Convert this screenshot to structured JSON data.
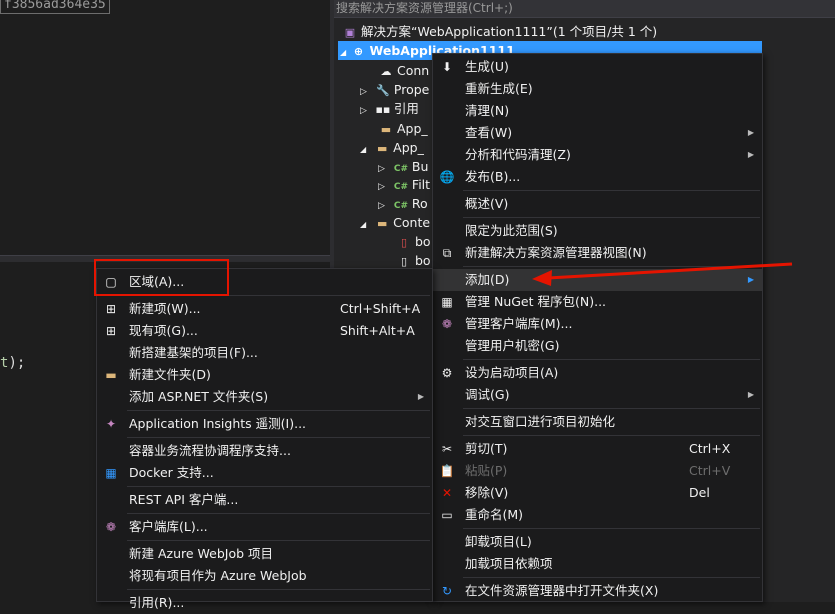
{
  "editor": {
    "hash_text": "f3856ad364e35",
    "code_prefix": "t",
    "code_suffix": ");"
  },
  "solution_explorer": {
    "search_placeholder": "搜索解决方案资源管理器(Ctrl+;)",
    "solution_label": "解决方案“WebApplication1111”(1 个项目/共 1 个)",
    "project_label": "WebApplication1111",
    "items": [
      "Conn",
      "Prope",
      "引用",
      "App_",
      "App_",
      "Bu",
      "Filt",
      "Ro",
      "Conte",
      "bo",
      "bo"
    ]
  },
  "context_menu": {
    "items": [
      {
        "label": "生成(U)"
      },
      {
        "label": "重新生成(E)"
      },
      {
        "label": "清理(N)"
      },
      {
        "label": "查看(W)"
      },
      {
        "label": "分析和代码清理(Z)"
      },
      {
        "label": "发布(B)..."
      },
      {
        "label": "概述(V)"
      },
      {
        "label": "限定为此范围(S)"
      },
      {
        "label": "新建解决方案资源管理器视图(N)"
      },
      {
        "label": "添加(D)"
      },
      {
        "label": "管理 NuGet 程序包(N)..."
      },
      {
        "label": "管理客户端库(M)..."
      },
      {
        "label": "管理用户机密(G)"
      },
      {
        "label": "设为启动项目(A)"
      },
      {
        "label": "调试(G)"
      },
      {
        "label": "对交互窗口进行项目初始化"
      },
      {
        "label": "剪切(T)",
        "shortcut": "Ctrl+X"
      },
      {
        "label": "粘贴(P)",
        "shortcut": "Ctrl+V"
      },
      {
        "label": "移除(V)",
        "shortcut": "Del"
      },
      {
        "label": "重命名(M)"
      },
      {
        "label": "卸载项目(L)"
      },
      {
        "label": "加载项目依赖项"
      },
      {
        "label": "在文件资源管理器中打开文件夹(X)"
      }
    ]
  },
  "add_submenu": {
    "items": [
      {
        "label": "区域(A)..."
      },
      {
        "label": "新建项(W)...",
        "shortcut": "Ctrl+Shift+A"
      },
      {
        "label": "现有项(G)...",
        "shortcut": "Shift+Alt+A"
      },
      {
        "label": "新搭建基架的项目(F)..."
      },
      {
        "label": "新建文件夹(D)"
      },
      {
        "label": "添加 ASP.NET 文件夹(S)"
      },
      {
        "label": "Application Insights 遥测(I)..."
      },
      {
        "label": "容器业务流程协调程序支持..."
      },
      {
        "label": "Docker 支持..."
      },
      {
        "label": "REST API 客户端..."
      },
      {
        "label": "客户端库(L)..."
      },
      {
        "label": "新建 Azure WebJob 项目"
      },
      {
        "label": "将现有项目作为 Azure WebJob"
      },
      {
        "label": "引用(R)..."
      }
    ]
  },
  "colors": {
    "accent": "#3399ff",
    "highlight_red": "#e51400"
  }
}
